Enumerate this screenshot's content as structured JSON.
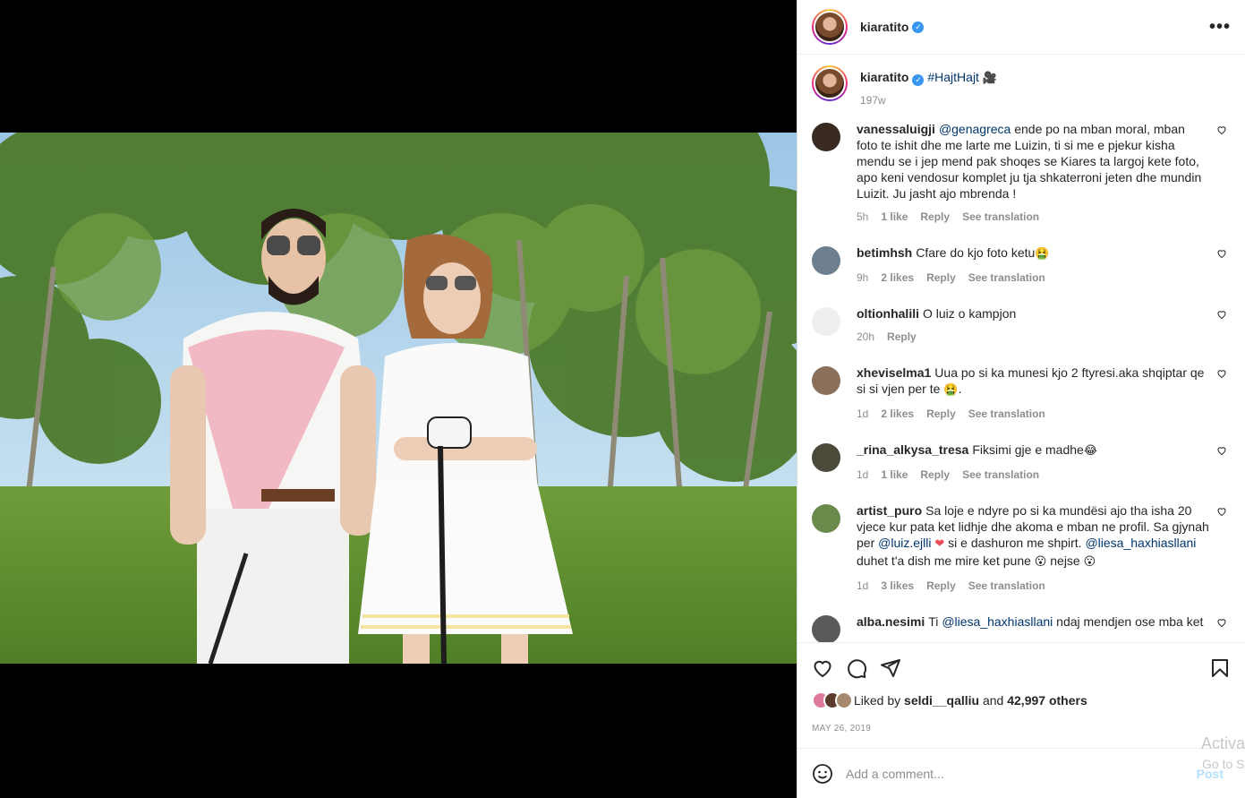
{
  "header": {
    "username": "kiaratito",
    "more_label": "•••"
  },
  "caption": {
    "username": "kiaratito",
    "text": "#HajtHajt",
    "emoji": "🎥",
    "time": "197w"
  },
  "comments": [
    {
      "username": "vanessaluigji",
      "mention": "@genagreca",
      "text": " ende po na mban moral, mban foto te ishit dhe me larte me Luizin, ti si me e pjekur kisha mendu se i jep mend pak shoqes se Kiares ta largoj kete foto, apo keni vendosur komplet ju tja shkaterroni jeten dhe mundin Luizit. Ju jasht ajo mbrenda !",
      "time": "5h",
      "likes": "1 like",
      "reply": "Reply",
      "translate": "See translation",
      "avatar_color": "#3a2b22"
    },
    {
      "username": "betimhsh",
      "text": "Cfare do kjo foto ketu",
      "emoji": "🤮",
      "time": "9h",
      "likes": "2 likes",
      "reply": "Reply",
      "translate": "See translation",
      "avatar_color": "#6d7f8f"
    },
    {
      "username": "oltionhalili",
      "text": "O luiz o kampjon",
      "time": "20h",
      "reply": "Reply",
      "avatar_color": "#efefef"
    },
    {
      "username": "xheviselma1",
      "text": "Uua po si ka munesi kjo 2 ftyresi.aka shqiptar qe si si vjen per te",
      "emoji": "🤮.",
      "time": "1d",
      "likes": "2 likes",
      "reply": "Reply",
      "translate": "See translation",
      "avatar_color": "#8a6f5a"
    },
    {
      "username": "_rina_alkysa_tresa",
      "text": "Fiksimi gje e madhe",
      "emoji": "😂",
      "time": "1d",
      "likes": "1 like",
      "reply": "Reply",
      "translate": "See translation",
      "avatar_color": "#4b4a3a"
    },
    {
      "username": "artist_puro",
      "text1": "Sa loje e ndyre po si ka mundësi ajo tha isha 20 vjece kur pata ket lidhje dhe akoma e mban ne profil. Sa gjynah per",
      "mention1": "@luiz.ejlli",
      "emoji1": "❤",
      "text2": "si e dashuron me shpirt.",
      "mention2": "@liesa_haxhiasllani",
      "text3": "duhet t'a dish me mire ket pune",
      "emoji2": "😮",
      "text4": "nejse",
      "emoji3": "😮",
      "time": "1d",
      "likes": "3 likes",
      "reply": "Reply",
      "translate": "See translation",
      "avatar_color": "#6a8a4c"
    },
    {
      "username": "alba.nesimi",
      "text": "Ti",
      "mention": "@liesa_haxhiasllani",
      "text2": "ndaj mendjen ose mba ket",
      "avatar_color": "#5a5a5a"
    }
  ],
  "liked_by": {
    "prefix": "Liked by",
    "user": "seldi__qalliu",
    "and": "and",
    "count": "42,997 others"
  },
  "date": "MAY 26, 2019",
  "add_comment": {
    "placeholder": "Add a comment...",
    "post_label": "Post"
  },
  "watermark": {
    "line1": "Activa",
    "line2": "Go to S"
  }
}
